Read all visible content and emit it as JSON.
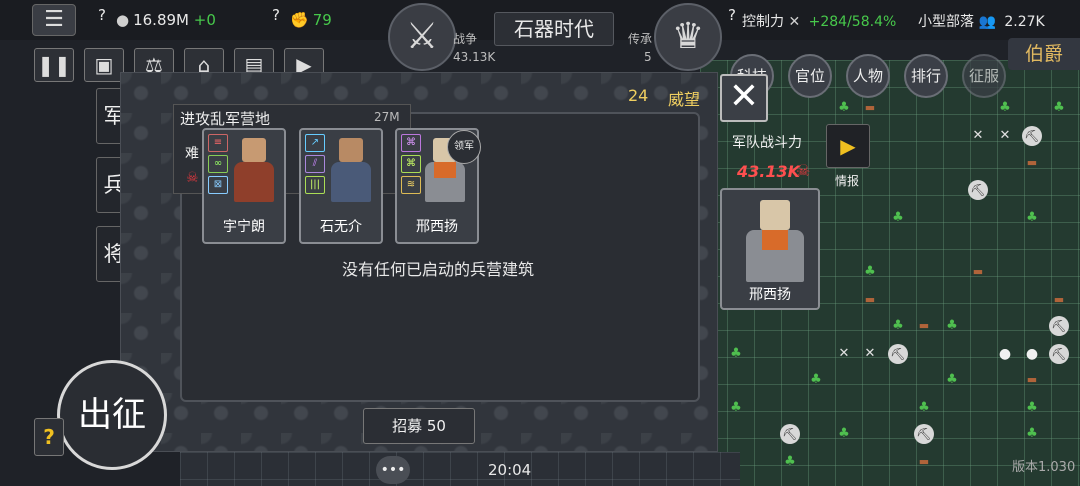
{
  "topbar": {
    "menu_icon": "menu-icon",
    "info_glyph_1": "?",
    "food_value": "16.89M",
    "food_delta": "+0",
    "info_glyph_2": "?",
    "strength_value": "79",
    "war_label": "战争",
    "war_value": "43.13K",
    "era_title": "石器时代",
    "heritage_label": "传承",
    "heritage_value": "5",
    "info_glyph_3": "?",
    "control_label": "控制力",
    "control_delta": "+284",
    "control_pct": "/58.4%",
    "tribe_label": "小型部落",
    "tribe_value": "2.27K"
  },
  "toolbar": {
    "buttons": [
      "pause",
      "save",
      "balance",
      "house",
      "book",
      "film"
    ]
  },
  "categories": {
    "tech": "科技",
    "office": "官位",
    "people": "人物",
    "ranking": "排行",
    "locked": "征服"
  },
  "rank_badge": "伯爵",
  "side_tabs": {
    "army": "军队",
    "troops": "兵种",
    "general": "将军"
  },
  "dialog": {
    "prestige_value": "24",
    "prestige_label": "威望",
    "close_glyph": "✕",
    "attack_title": "进攻乱军营地",
    "attack_amount": "27M",
    "attack_difficulty": "难",
    "generals": [
      {
        "name": "宇宁朗"
      },
      {
        "name": "石无介"
      },
      {
        "name": "邢西扬"
      }
    ],
    "leader_label": "领军",
    "empty_message": "没有任何已启动的兵营建筑",
    "recruit_label": "招募 50"
  },
  "army_panel": {
    "power_label": "军队战斗力",
    "power_value": "43.13K",
    "intel_label": "情报",
    "general_name": "邢西扬"
  },
  "deploy_label": "出征",
  "help_glyph": "?",
  "clock": "20:04",
  "version": "版本1.030",
  "colors": {
    "accent_gold": "#f0cf60",
    "danger_red": "#ff4f4f",
    "positive_green": "#47c84b"
  }
}
